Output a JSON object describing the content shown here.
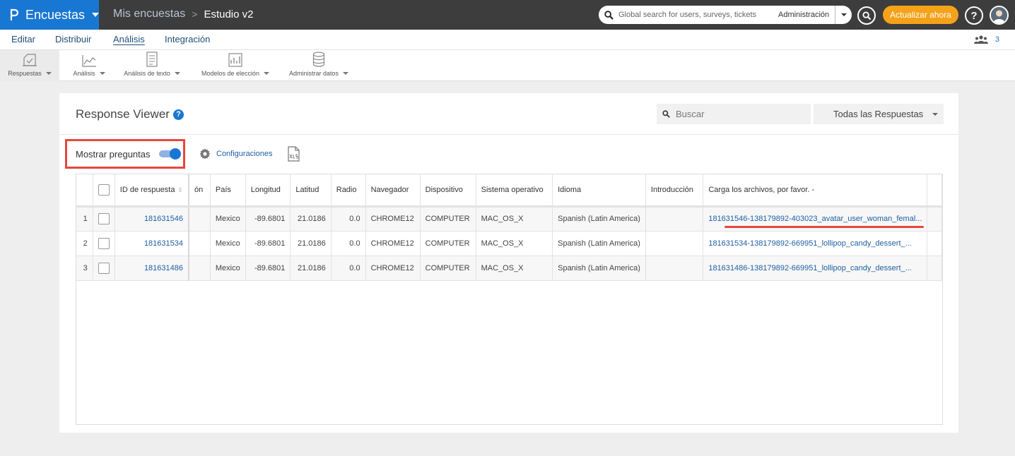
{
  "topbar": {
    "app_name": "Encuestas",
    "breadcrumb_root": "Mis encuestas",
    "breadcrumb_sep": ">",
    "breadcrumb_current": "Estudio v2",
    "search_placeholder": "Global search for users, surveys, tickets",
    "search_scope": "Administración",
    "upgrade_label": "Actualizar ahora",
    "help_label": "?",
    "brand_color": "#1877d2",
    "upgrade_color": "#f5a21b"
  },
  "mainnav": {
    "items": [
      {
        "label": "Editar"
      },
      {
        "label": "Distribuir"
      },
      {
        "label": "Análisis"
      },
      {
        "label": "Integración"
      }
    ],
    "active": "Análisis",
    "collaborators_count": "3"
  },
  "toolbar": {
    "items": [
      {
        "label": "Respuestas",
        "icon": "responses-icon"
      },
      {
        "label": "Análisis",
        "icon": "chart-icon"
      },
      {
        "label": "Análisis de texto",
        "icon": "text-analysis-icon"
      },
      {
        "label": "Modelos de elección",
        "icon": "choice-model-icon"
      },
      {
        "label": "Administrar datos",
        "icon": "database-icon"
      }
    ],
    "active": "Respuestas"
  },
  "viewer": {
    "title": "Response Viewer",
    "help": "?",
    "search_placeholder": "Buscar",
    "filter_value": "Todas las Respuestas",
    "show_questions_label": "Mostrar preguntas",
    "show_questions_on": true,
    "settings_label": "Configuraciones",
    "export_icon": "xls-icon",
    "highlight_color": "#e8473c"
  },
  "table": {
    "columns": {
      "id": "ID de respuesta",
      "partial": "ón",
      "country": "País",
      "longitude": "Longitud",
      "latitude": "Latitud",
      "radius": "Radio",
      "browser": "Navegador",
      "device": "Dispositivo",
      "os": "Sistema operativo",
      "language": "Idioma",
      "intro": "Introducción",
      "upload": "Carga los archivos, por favor. -"
    },
    "rows": [
      {
        "n": "1",
        "id": "181631546",
        "country": "Mexico",
        "longitude": "-89.6801",
        "latitude": "21.0186",
        "radius": "0.0",
        "browser": "CHROME12",
        "device": "COMPUTER",
        "os": "MAC_OS_X",
        "language": "Spanish (Latin America)",
        "intro": "",
        "upload": "181631546-138179892-403023_avatar_user_woman_femal..."
      },
      {
        "n": "2",
        "id": "181631534",
        "country": "Mexico",
        "longitude": "-89.6801",
        "latitude": "21.0186",
        "radius": "0.0",
        "browser": "CHROME12",
        "device": "COMPUTER",
        "os": "MAC_OS_X",
        "language": "Spanish (Latin America)",
        "intro": "",
        "upload": "181631534-138179892-669951_lollipop_candy_dessert_..."
      },
      {
        "n": "3",
        "id": "181631486",
        "country": "Mexico",
        "longitude": "-89.6801",
        "latitude": "21.0186",
        "radius": "0.0",
        "browser": "CHROME12",
        "device": "COMPUTER",
        "os": "MAC_OS_X",
        "language": "Spanish (Latin America)",
        "intro": "",
        "upload": "181631486-138179892-669951_lollipop_candy_dessert_..."
      }
    ]
  }
}
